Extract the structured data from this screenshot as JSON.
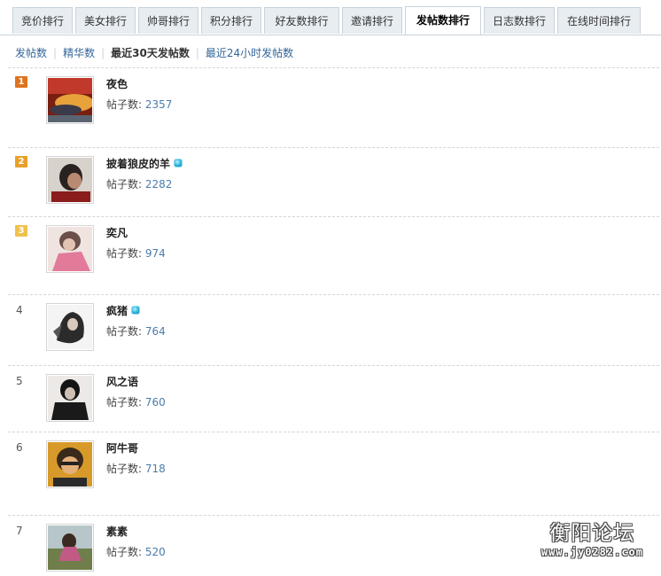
{
  "tabs": [
    {
      "label": "竞价排行"
    },
    {
      "label": "美女排行"
    },
    {
      "label": "帅哥排行"
    },
    {
      "label": "积分排行"
    },
    {
      "label": "好友数排行"
    },
    {
      "label": "邀请排行"
    },
    {
      "label": "发帖数排行",
      "active": true
    },
    {
      "label": "日志数排行"
    },
    {
      "label": "在线时间排行"
    }
  ],
  "subnav": {
    "posts": "发帖数",
    "digest": "精华数",
    "last30": "最近30天发帖数",
    "last24": "最近24小时发帖数"
  },
  "count_label": "帖子数:",
  "rank_colors": {
    "1": "#e0731f",
    "2": "#e9a02a",
    "3": "#efc14d"
  },
  "rankings": [
    {
      "rank": "1",
      "name": "夜色",
      "count": "2357",
      "vip": false
    },
    {
      "rank": "2",
      "name": "披着狼皮的羊",
      "count": "2282",
      "vip": true
    },
    {
      "rank": "3",
      "name": "奕凡",
      "count": "974",
      "vip": false
    },
    {
      "rank": "4",
      "name": "疯猪",
      "count": "764",
      "vip": true
    },
    {
      "rank": "5",
      "name": "风之语",
      "count": "760",
      "vip": false
    },
    {
      "rank": "6",
      "name": "阿牛哥",
      "count": "718",
      "vip": false
    },
    {
      "rank": "7",
      "name": "素素",
      "count": "520",
      "vip": false
    }
  ],
  "watermark": {
    "title": "衡阳论坛",
    "url": "www.jy0282.com"
  }
}
